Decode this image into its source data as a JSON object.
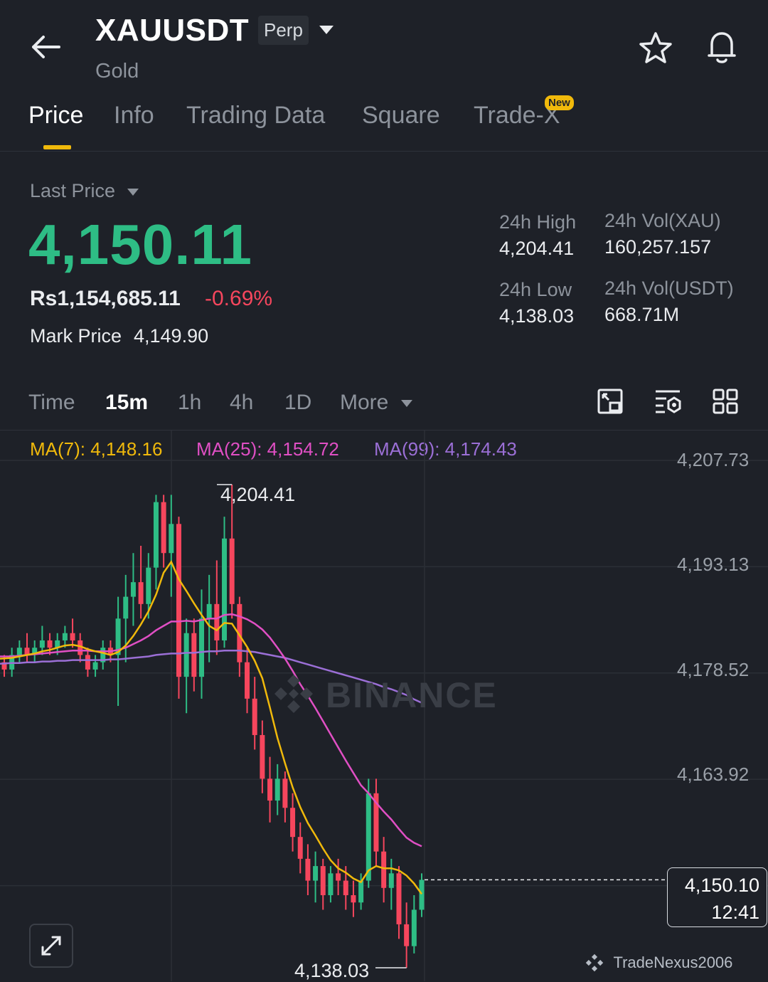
{
  "header": {
    "symbol": "XAUUSDT",
    "contract_type": "Perp",
    "asset_name": "Gold",
    "icons": [
      "back-arrow-icon",
      "dropdown-triangle-icon",
      "star-icon",
      "bell-icon"
    ]
  },
  "tabs": [
    {
      "label": "Price",
      "active": true
    },
    {
      "label": "Info"
    },
    {
      "label": "Trading Data"
    },
    {
      "label": "Square"
    },
    {
      "label": "Trade-X",
      "badge": "New"
    }
  ],
  "ticker": {
    "price_type_label": "Last Price",
    "last_price": "4,150.11",
    "fiat_price": "Rs1,154,685.11",
    "change_pct": "-0.69%",
    "mark_price_label": "Mark Price",
    "mark_price": "4,149.90"
  },
  "stats": {
    "high_label": "24h High",
    "high_value": "4,204.41",
    "low_label": "24h Low",
    "low_value": "4,138.03",
    "vol_base_label": "24h Vol(XAU)",
    "vol_base_value": "160,257.157",
    "vol_quote_label": "24h Vol(USDT)",
    "vol_quote_value": "668.71M"
  },
  "timeframes": {
    "time_label": "Time",
    "options": [
      "15m",
      "1h",
      "4h",
      "1D"
    ],
    "selected": "15m",
    "more_label": "More",
    "tool_icons": [
      "chart-expand-icon",
      "indicator-settings-icon",
      "grid-layout-icon"
    ]
  },
  "indicators": {
    "ma7": "MA(7): 4,148.16",
    "ma25": "MA(25): 4,154.72",
    "ma99": "MA(99): 4,174.43",
    "colors": {
      "ma7": "#f0b90b",
      "ma25": "#e04fc4",
      "ma99": "#9b6fd6"
    }
  },
  "chart": {
    "y_ticks": [
      "4,207.73",
      "4,193.13",
      "4,178.52",
      "4,163.92"
    ],
    "high_annotation": "4,204.41",
    "low_annotation": "4,138.03",
    "current_price": "4,150.10",
    "countdown": "12:41",
    "watermark": "BINANCE",
    "attribution": "TradeNexus2006",
    "colors": {
      "up": "#2ebd85",
      "down": "#f6465d",
      "background": "#1e2128"
    }
  },
  "chart_data": {
    "type": "candlestick",
    "ylim": [
      4138.03,
      4207.73
    ],
    "candles": [
      [
        4180,
        4181,
        4178,
        4179
      ],
      [
        4179,
        4182,
        4178,
        4181
      ],
      [
        4181,
        4183,
        4180,
        4182
      ],
      [
        4182,
        4184,
        4180,
        4181
      ],
      [
        4181,
        4183,
        4180,
        4182
      ],
      [
        4182,
        4185,
        4181,
        4183
      ],
      [
        4183,
        4184,
        4181,
        4182
      ],
      [
        4182,
        4184,
        4181,
        4183
      ],
      [
        4183,
        4185,
        4182,
        4184
      ],
      [
        4184,
        4186,
        4182,
        4183
      ],
      [
        4183,
        4184,
        4180,
        4181
      ],
      [
        4181,
        4182,
        4178,
        4179
      ],
      [
        4179,
        4181,
        4178,
        4180
      ],
      [
        4180,
        4183,
        4179,
        4182
      ],
      [
        4182,
        4183,
        4180,
        4181
      ],
      [
        4181,
        4189,
        4174,
        4186
      ],
      [
        4186,
        4192,
        4180,
        4189
      ],
      [
        4189,
        4195,
        4185,
        4191
      ],
      [
        4191,
        4196,
        4186,
        4188
      ],
      [
        4188,
        4195,
        4186,
        4193
      ],
      [
        4193,
        4203,
        4190,
        4202
      ],
      [
        4202,
        4203,
        4193,
        4195
      ],
      [
        4195,
        4203,
        4189,
        4199
      ],
      [
        4199,
        4200,
        4175,
        4178
      ],
      [
        4178,
        4186,
        4173,
        4184
      ],
      [
        4184,
        4186,
        4176,
        4178
      ],
      [
        4178,
        4190,
        4175,
        4186
      ],
      [
        4186,
        4192,
        4180,
        4188
      ],
      [
        4188,
        4194,
        4181,
        4183
      ],
      [
        4183,
        4200,
        4182,
        4197
      ],
      [
        4197,
        4204.41,
        4186,
        4188
      ],
      [
        4188,
        4189,
        4178,
        4180
      ],
      [
        4180,
        4182,
        4173,
        4175
      ],
      [
        4175,
        4178,
        4168,
        4170
      ],
      [
        4170,
        4172,
        4162,
        4164
      ],
      [
        4164,
        4167,
        4158,
        4161
      ],
      [
        4161,
        4166,
        4159,
        4164
      ],
      [
        4164,
        4165,
        4158,
        4160
      ],
      [
        4160,
        4162,
        4154,
        4156
      ],
      [
        4156,
        4158,
        4151,
        4153
      ],
      [
        4153,
        4155,
        4148,
        4150
      ],
      [
        4150,
        4154,
        4147,
        4152
      ],
      [
        4152,
        4153,
        4146,
        4148
      ],
      [
        4148,
        4152,
        4147,
        4151
      ],
      [
        4151,
        4153,
        4148,
        4150
      ],
      [
        4150,
        4152,
        4146,
        4148
      ],
      [
        4148,
        4150,
        4145,
        4147
      ],
      [
        4147,
        4151,
        4146,
        4150
      ],
      [
        4150,
        4164,
        4149,
        4162
      ],
      [
        4162,
        4164,
        4152,
        4154
      ],
      [
        4154,
        4156,
        4147,
        4149
      ],
      [
        4149,
        4153,
        4146,
        4151
      ],
      [
        4151,
        4152,
        4142,
        4144
      ],
      [
        4144,
        4147,
        4138.03,
        4141
      ],
      [
        4141,
        4148,
        4140,
        4146
      ],
      [
        4146,
        4151,
        4145,
        4150.11
      ]
    ],
    "ma7": [
      4180.5,
      4180.6,
      4180.8,
      4181.0,
      4181.2,
      4181.5,
      4181.7,
      4182.0,
      4182.3,
      4182.4,
      4182.2,
      4181.8,
      4181.5,
      4181.3,
      4181.0,
      4181.4,
      4182.3,
      4183.6,
      4185.2,
      4187.0,
      4189.3,
      4192.3,
      4193.8,
      4191.4,
      4189.8,
      4188.1,
      4186.5,
      4185.0,
      4184.4,
      4185.4,
      4185.3,
      4183.7,
      4182.1,
      4180.2,
      4177.8,
      4173.8,
      4169.6,
      4166.1,
      4162.8,
      4160.1,
      4157.9,
      4156.2,
      4154.4,
      4152.8,
      4151.7,
      4151.1,
      4150.3,
      4149.8,
      4151.4,
      4152.0,
      4151.7,
      4151.7,
      4151.4,
      4150.7,
      4149.6,
      4148.16
    ],
    "ma25": [
      4180.8,
      4180.8,
      4180.9,
      4181.0,
      4181.1,
      4181.2,
      4181.3,
      4181.4,
      4181.5,
      4181.6,
      4181.6,
      4181.6,
      4181.5,
      4181.5,
      4181.5,
      4181.7,
      4182.0,
      4182.5,
      4183.0,
      4183.6,
      4184.4,
      4185.0,
      4185.6,
      4185.6,
      4185.7,
      4185.6,
      4185.8,
      4186.0,
      4186.0,
      4186.5,
      4186.6,
      4186.3,
      4185.9,
      4185.3,
      4184.5,
      4183.4,
      4182.0,
      4180.5,
      4178.8,
      4177.0,
      4175.4,
      4173.7,
      4171.9,
      4170.1,
      4168.3,
      4166.5,
      4164.8,
      4163.1,
      4162.0,
      4160.7,
      4159.5,
      4158.4,
      4157.1,
      4155.9,
      4155.2,
      4154.72
    ],
    "ma99": [
      4179.8,
      4179.9,
      4179.9,
      4180.0,
      4180.0,
      4180.1,
      4180.1,
      4180.2,
      4180.2,
      4180.3,
      4180.3,
      4180.3,
      4180.3,
      4180.3,
      4180.4,
      4180.4,
      4180.5,
      4180.6,
      4180.7,
      4180.8,
      4181.0,
      4181.1,
      4181.2,
      4181.2,
      4181.3,
      4181.3,
      4181.4,
      4181.5,
      4181.5,
      4181.6,
      4181.6,
      4181.6,
      4181.5,
      4181.4,
      4181.2,
      4181.0,
      4180.8,
      4180.6,
      4180.3,
      4180.0,
      4179.7,
      4179.4,
      4179.1,
      4178.8,
      4178.5,
      4178.2,
      4177.9,
      4177.6,
      4177.3,
      4177.0,
      4176.6,
      4176.3,
      4175.9,
      4175.5,
      4174.9,
      4174.43
    ]
  }
}
